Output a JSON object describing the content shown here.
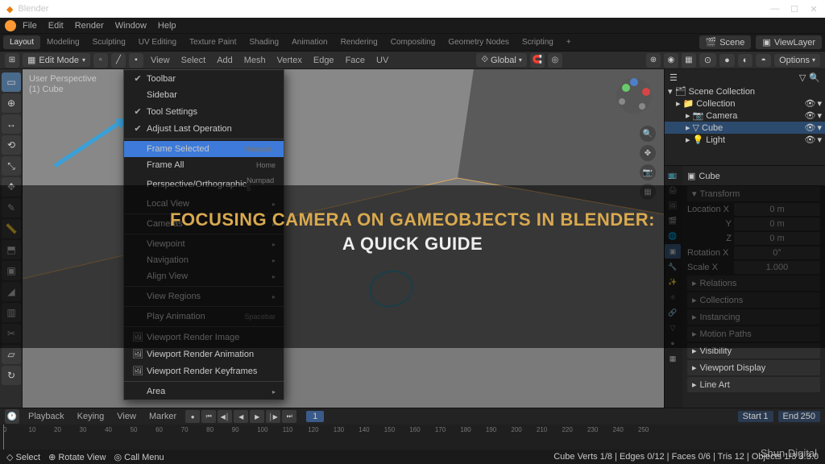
{
  "titlebar": {
    "title": "Blender",
    "min": "—",
    "max": "☐",
    "close": "✕"
  },
  "menubar": {
    "items": [
      "File",
      "Edit",
      "Render",
      "Window",
      "Help"
    ]
  },
  "workspaces": {
    "tabs": [
      "Layout",
      "Modeling",
      "Sculpting",
      "UV Editing",
      "Texture Paint",
      "Shading",
      "Animation",
      "Rendering",
      "Compositing",
      "Geometry Nodes",
      "Scripting"
    ],
    "activeIndex": 0,
    "scene_label": "Scene",
    "scene_value": "Scene",
    "viewlayer_label": "ViewLayer"
  },
  "toolbar3d": {
    "mode": "Edit Mode",
    "menus": [
      "View",
      "Select",
      "Add",
      "Mesh",
      "Vertex",
      "Edge",
      "Face",
      "UV"
    ],
    "orientation": "Global",
    "options": "Options"
  },
  "viewport": {
    "persp": "User Perspective",
    "object": "(1) Cube"
  },
  "view_menu": {
    "items": [
      {
        "label": "Toolbar",
        "type": "check",
        "checked": true,
        "shortcut": ""
      },
      {
        "label": "Sidebar",
        "type": "check",
        "checked": false,
        "shortcut": ""
      },
      {
        "label": "Tool Settings",
        "type": "check",
        "checked": true,
        "shortcut": ""
      },
      {
        "label": "Adjust Last Operation",
        "type": "check",
        "checked": true,
        "shortcut": ""
      },
      {
        "type": "sep"
      },
      {
        "label": "Frame Selected",
        "type": "item",
        "shortcut": "Numpad .",
        "highlighted": true
      },
      {
        "label": "Frame All",
        "type": "item",
        "shortcut": "Home"
      },
      {
        "label": "Perspective/Orthographic",
        "type": "item",
        "shortcut": "Numpad 5"
      },
      {
        "label": "Local View",
        "type": "sub"
      },
      {
        "type": "sep"
      },
      {
        "label": "Cameras",
        "type": "sub"
      },
      {
        "type": "sep"
      },
      {
        "label": "Viewpoint",
        "type": "sub"
      },
      {
        "label": "Navigation",
        "type": "sub"
      },
      {
        "label": "Align View",
        "type": "sub"
      },
      {
        "type": "sep"
      },
      {
        "label": "View Regions",
        "type": "sub"
      },
      {
        "type": "sep"
      },
      {
        "label": "Play Animation",
        "type": "item",
        "shortcut": "Spacebar"
      },
      {
        "type": "sep"
      },
      {
        "label": "Viewport Render Image",
        "type": "item",
        "icon": "🖼"
      },
      {
        "label": "Viewport Render Animation",
        "type": "item",
        "icon": "🖼"
      },
      {
        "label": "Viewport Render Keyframes",
        "type": "item",
        "icon": "🖼"
      },
      {
        "type": "sep"
      },
      {
        "label": "Area",
        "type": "sub"
      }
    ]
  },
  "outliner": {
    "title": "Scene Collection",
    "rows": [
      {
        "label": "Collection",
        "indent": 1,
        "icon": "📁"
      },
      {
        "label": "Camera",
        "indent": 2,
        "icon": "📷"
      },
      {
        "label": "Cube",
        "indent": 2,
        "icon": "▽",
        "sel": true
      },
      {
        "label": "Light",
        "indent": 2,
        "icon": "💡"
      }
    ]
  },
  "properties": {
    "object": "Cube",
    "transform_title": "Transform",
    "loc": "Location X",
    "rot": "Rotation X",
    "scale": "Scale X",
    "v0": "0 m",
    "v1": "0°",
    "v2": "1.000",
    "panels": [
      "Relations",
      "Collections",
      "Instancing",
      "Motion Paths",
      "Visibility",
      "Viewport Display",
      "Line Art"
    ]
  },
  "timeline": {
    "menus": [
      "Playback",
      "Keying",
      "View",
      "Marker"
    ],
    "current": 1,
    "start_label": "Start",
    "start": 1,
    "end_label": "End",
    "end": 250,
    "ticks": [
      0,
      10,
      20,
      30,
      40,
      50,
      60,
      70,
      80,
      90,
      100,
      110,
      120,
      130,
      140,
      150,
      160,
      170,
      180,
      190,
      200,
      210,
      220,
      230,
      240,
      250
    ]
  },
  "statusbar": {
    "left": [
      "◇ Select",
      "⊕ Rotate View",
      "◎ Call Menu"
    ],
    "right": "Cube    Verts 1/8 | Edges 0/12 | Faces 0/6 | Tris 12 | Objects 1/3    3.3.0"
  },
  "overlay": {
    "line1": "FOCUSING CAMERA ON GAMEOBJECTS IN BLENDER:",
    "line2": "A QUICK GUIDE"
  },
  "watermark": "Shun Digital"
}
